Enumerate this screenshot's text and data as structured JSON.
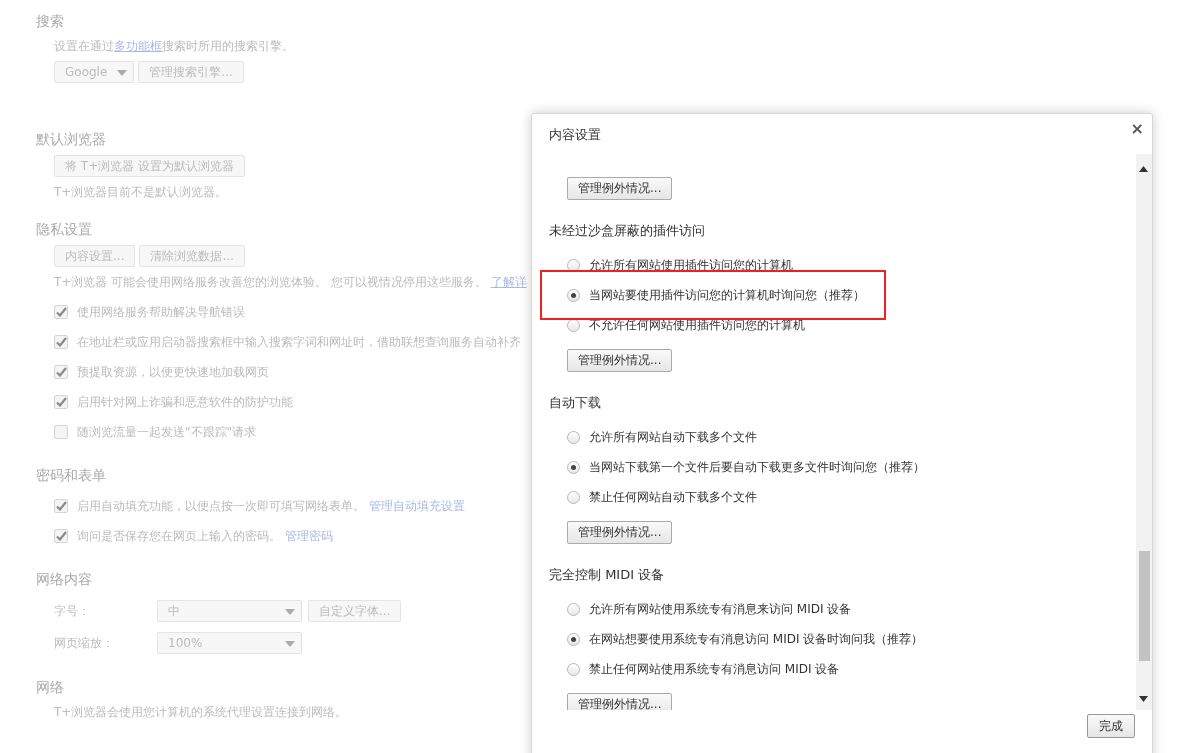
{
  "settings": {
    "sections": [
      {
        "heading": "搜索",
        "items": [
          {
            "kind": "text",
            "parts": [
              {
                "text": "设置在通过"
              },
              {
                "text": "多功能框",
                "link": true
              },
              {
                "text": "搜索时所用的搜索引擎。"
              }
            ]
          },
          {
            "kind": "controls",
            "controls": [
              {
                "kind": "select",
                "value": "Google"
              },
              {
                "kind": "button",
                "label": "管理搜索引擎..."
              }
            ]
          }
        ]
      },
      {
        "heading": "默认浏览器",
        "items": [
          {
            "kind": "controls",
            "controls": [
              {
                "kind": "button",
                "label": "将 T+浏览器 设置为默认浏览器"
              }
            ]
          },
          {
            "kind": "text",
            "parts": [
              {
                "text": "T+浏览器目前不是默认浏览器。"
              }
            ]
          }
        ]
      },
      {
        "heading": "隐私设置",
        "items": [
          {
            "kind": "controls",
            "controls": [
              {
                "kind": "button",
                "label": "内容设置..."
              },
              {
                "kind": "button",
                "label": "清除浏览数据..."
              }
            ]
          },
          {
            "kind": "text",
            "parts": [
              {
                "text": "T+浏览器 可能会使用网络服务改善您的浏览体验。 您可以视情况停用这些服务。 "
              },
              {
                "text": "了解详",
                "link": true
              }
            ]
          },
          {
            "kind": "checkbox",
            "checked": true,
            "parts": [
              {
                "text": "使用网络服务帮助解决导航错误"
              }
            ]
          },
          {
            "kind": "checkbox",
            "checked": true,
            "parts": [
              {
                "text": "在地址栏或应用启动器搜索框中输入搜索字词和网址时，借助联想查询服务自动补齐"
              }
            ]
          },
          {
            "kind": "checkbox",
            "checked": true,
            "parts": [
              {
                "text": "预提取资源，以便更快速地加载网页"
              }
            ]
          },
          {
            "kind": "checkbox",
            "checked": true,
            "parts": [
              {
                "text": "启用针对网上诈骗和恶意软件的防护功能"
              }
            ]
          },
          {
            "kind": "checkbox",
            "checked": false,
            "parts": [
              {
                "text": "随浏览流量一起发送\"不跟踪\"请求"
              }
            ]
          }
        ]
      },
      {
        "heading": "密码和表单",
        "items": [
          {
            "kind": "checkbox",
            "checked": true,
            "parts": [
              {
                "text": "启用自动填充功能，以便点按一次即可填写网络表单。 "
              },
              {
                "text": "管理自动填充设置",
                "link": true
              }
            ]
          },
          {
            "kind": "checkbox",
            "checked": true,
            "parts": [
              {
                "text": "询问是否保存您在网页上输入的密码。 "
              },
              {
                "text": "管理密码",
                "link": true
              }
            ]
          }
        ]
      },
      {
        "heading": "网络内容",
        "items": [
          {
            "kind": "field_row",
            "label": "字号：",
            "controls": [
              {
                "kind": "select",
                "value": "中"
              },
              {
                "kind": "button",
                "label": "自定义字体..."
              }
            ]
          },
          {
            "kind": "field_row",
            "label": "网页缩放：",
            "controls": [
              {
                "kind": "select",
                "value": "100%"
              }
            ]
          }
        ]
      },
      {
        "heading": "网络",
        "items": [
          {
            "kind": "text",
            "parts": [
              {
                "text": "T+浏览器会使用您计算机的系统代理设置连接到网络。"
              }
            ]
          }
        ]
      }
    ]
  },
  "dialog": {
    "title": "内容设置",
    "close": "×",
    "groups": [
      {
        "button": "管理例外情况..."
      },
      {
        "heading": "未经过沙盒屏蔽的插件访问",
        "options": [
          {
            "label": "允许所有网站使用插件访问您的计算机",
            "selected": false,
            "highlighted": false
          },
          {
            "label": "当网站要使用插件访问您的计算机时询问您（推荐）",
            "selected": true,
            "highlighted": true
          },
          {
            "label": "不允许任何网站使用插件访问您的计算机",
            "selected": false,
            "highlighted": false
          }
        ],
        "button": "管理例外情况..."
      },
      {
        "heading": "自动下载",
        "options": [
          {
            "label": "允许所有网站自动下载多个文件",
            "selected": false,
            "highlighted": false
          },
          {
            "label": "当网站下载第一个文件后要自动下载更多文件时询问您（推荐）",
            "selected": true,
            "highlighted": false
          },
          {
            "label": "禁止任何网站自动下载多个文件",
            "selected": false,
            "highlighted": false
          }
        ],
        "button": "管理例外情况..."
      },
      {
        "heading": "完全控制 MIDI 设备",
        "options": [
          {
            "label": "允许所有网站使用系统专有消息来访问 MIDI 设备",
            "selected": false,
            "highlighted": false
          },
          {
            "label": "在网站想要使用系统专有消息访问 MIDI 设备时询问我（推荐）",
            "selected": true,
            "highlighted": false
          },
          {
            "label": "禁止任何网站使用系统专有消息访问 MIDI 设备",
            "selected": false,
            "highlighted": false
          }
        ],
        "button": "管理例外情况..."
      }
    ],
    "done": "完成"
  }
}
